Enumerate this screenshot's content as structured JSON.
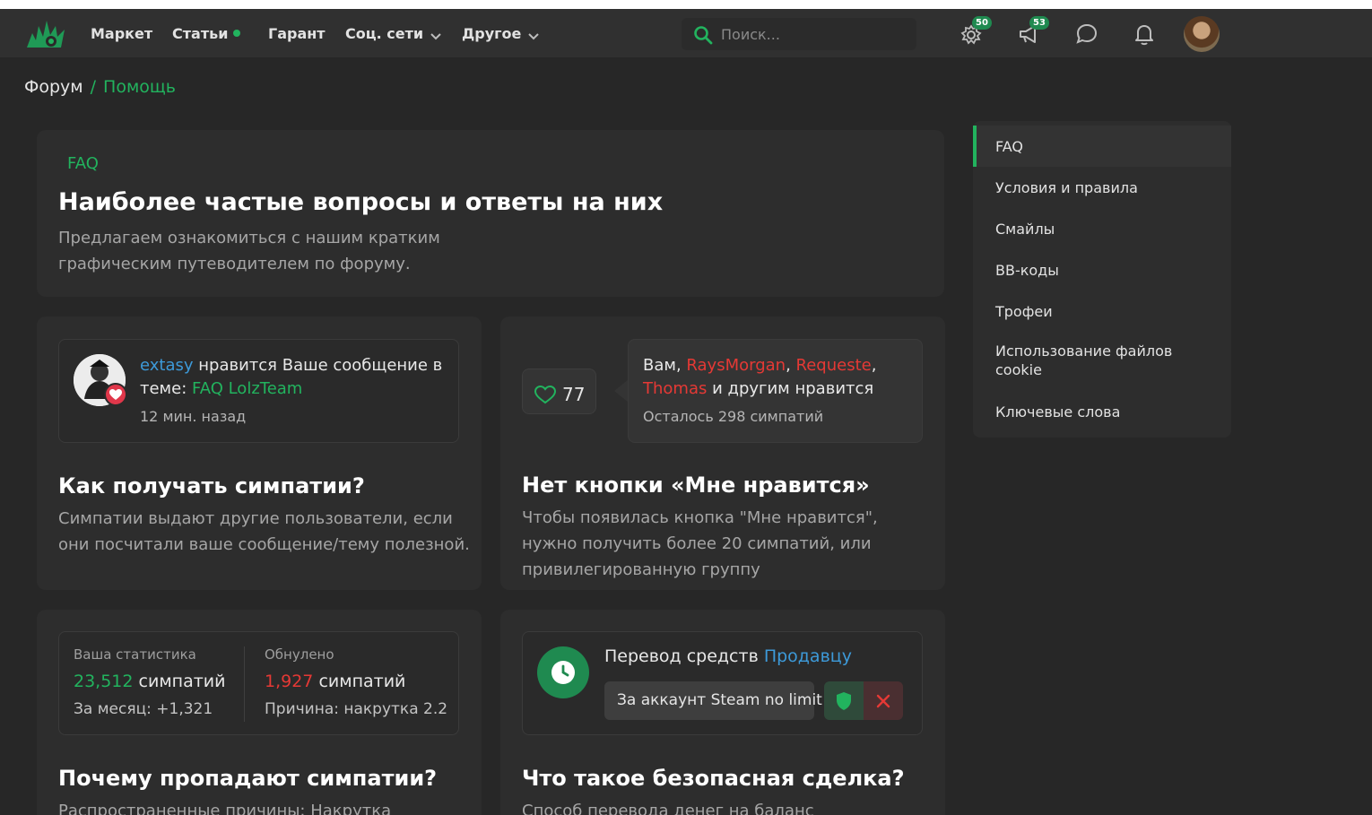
{
  "nav": {
    "items": [
      "Маркет",
      "Статьи",
      "Гарант",
      "Соц. сети",
      "Другое"
    ],
    "search_placeholder": "Поиск...",
    "badge_alerts": "50",
    "badge_conversations": "53"
  },
  "breadcrumb": {
    "home": "Форум",
    "sep": "/",
    "current": "Помощь"
  },
  "faq": {
    "label": "FAQ",
    "title": "Наиболее частые вопросы и ответы на них",
    "subtitle": "Предлагаем ознакомиться с нашим кратким графическим путеводителем по форуму."
  },
  "card1": {
    "user": "extasy",
    "text_a": " нравится Ваше сообщение в теме: ",
    "thread": "FAQ LolzTeam",
    "time": "12 мин. назад",
    "title": "Как получать симпатии?",
    "text": "Симпатии выдают другие пользователи, если они посчитали ваше сообщение/тему полезной."
  },
  "card2": {
    "likes": "77",
    "prefix": "Вам, ",
    "user1": "RaysMorgan",
    "comma1": ", ",
    "user2": "Requeste",
    "comma2": ", ",
    "user3": "Thomas",
    "suffix": " и другим нравится",
    "remaining": "Осталось 298 симпатий",
    "title": "Нет кнопки «Мне нравится»",
    "text": "Чтобы появилась кнопка \"Мне нравится\", нужно получить более 20 симпатий, или привилегированную группу"
  },
  "card3": {
    "label1": "Ваша статистика",
    "value1": "23,512",
    "unit": " симпатий",
    "extra1": "За месяц: +1,321",
    "label2": "Обнулено",
    "value2": "1,927",
    "extra2": "Причина: накрутка 2.2",
    "title": "Почему пропадают симпатии?",
    "text": "Распространенные причины: Накрутка"
  },
  "card4": {
    "transfer_text": "Перевод средств ",
    "transfer_target": "Продавцу",
    "chip": "За аккаунт Steam no limit",
    "title": "Что такое безопасная сделка?",
    "text": "Способ перевода денег на баланс"
  },
  "sidebar": {
    "items": [
      "FAQ",
      "Условия и правила",
      "Смайлы",
      "BB-коды",
      "Трофеи",
      "Использование файлов cookie",
      "Ключевые слова"
    ]
  }
}
